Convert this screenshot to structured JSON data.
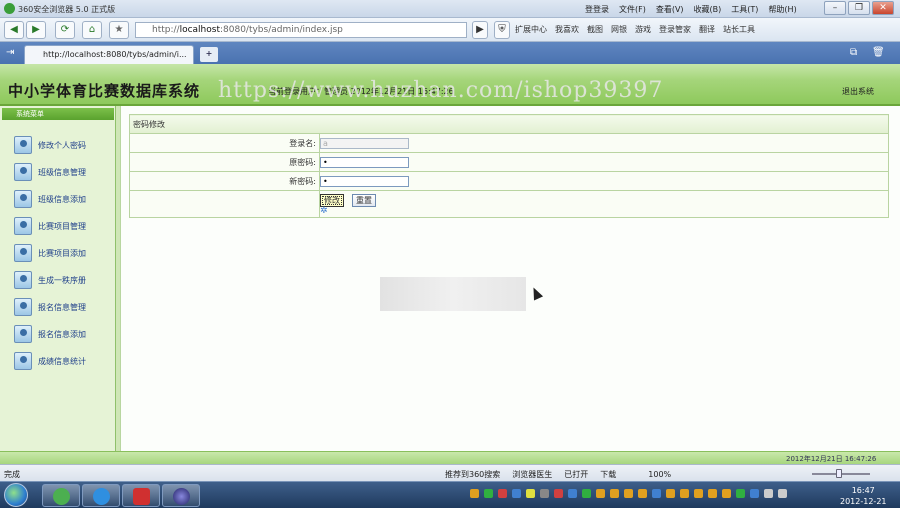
{
  "browser": {
    "title": "360安全浏览器 5.0 正式版",
    "menus": [
      "登登录",
      "文件(F)",
      "查看(V)",
      "收藏(B)",
      "工具(T)",
      "帮助(H)"
    ],
    "url_prefix": "http://",
    "url_domain": "localhost",
    "url_rest": ":8080/tybs/admin/index.jsp",
    "toolbar": [
      "扩展中心",
      "我喜欢",
      "截图",
      "网银",
      "游戏",
      "登录管家",
      "翻译",
      "站长工具"
    ],
    "tab_title": "http://localhost:8080/tybs/admin/i...",
    "tab_add": "+"
  },
  "app": {
    "title": "中小学体育比赛数据库系统",
    "user_info": "当前登录用户：管理员   2012年12月21日 16:47:26",
    "logout": "退出系统",
    "watermark": "https://www.huzhan.com/ishop39397"
  },
  "sidebar": {
    "header": "系统菜单",
    "items": [
      {
        "label": "修改个人密码"
      },
      {
        "label": "班级信息管理"
      },
      {
        "label": "班级信息添加"
      },
      {
        "label": "比赛项目管理"
      },
      {
        "label": "比赛项目添加"
      },
      {
        "label": "生成一秩序册"
      },
      {
        "label": "报名信息管理"
      },
      {
        "label": "报名信息添加"
      },
      {
        "label": "成绩信息统计"
      }
    ]
  },
  "form": {
    "heading": "密码修改",
    "login_label": "登录名:",
    "login_value": "a",
    "old_pw_label": "原密码:",
    "old_pw_value": "•",
    "new_pw_label": "新密码:",
    "new_pw_value": "•",
    "submit": "修改",
    "reset": "重置"
  },
  "footer": {
    "clock": "2012年12月21日  16:47:26"
  },
  "statusbar": {
    "status": "完成",
    "tools": [
      "推荐到360搜索",
      "浏览器医生",
      "已打开",
      "下载",
      "100%"
    ]
  },
  "taskbar": {
    "time": "16:47",
    "date": "2012-12-21"
  },
  "colors": {
    "header_green": "#8ec95c",
    "sidebar_bg": "#e6f3d6",
    "menu_text": "#1f3f8a",
    "taskbar": "#1f3a5e"
  }
}
